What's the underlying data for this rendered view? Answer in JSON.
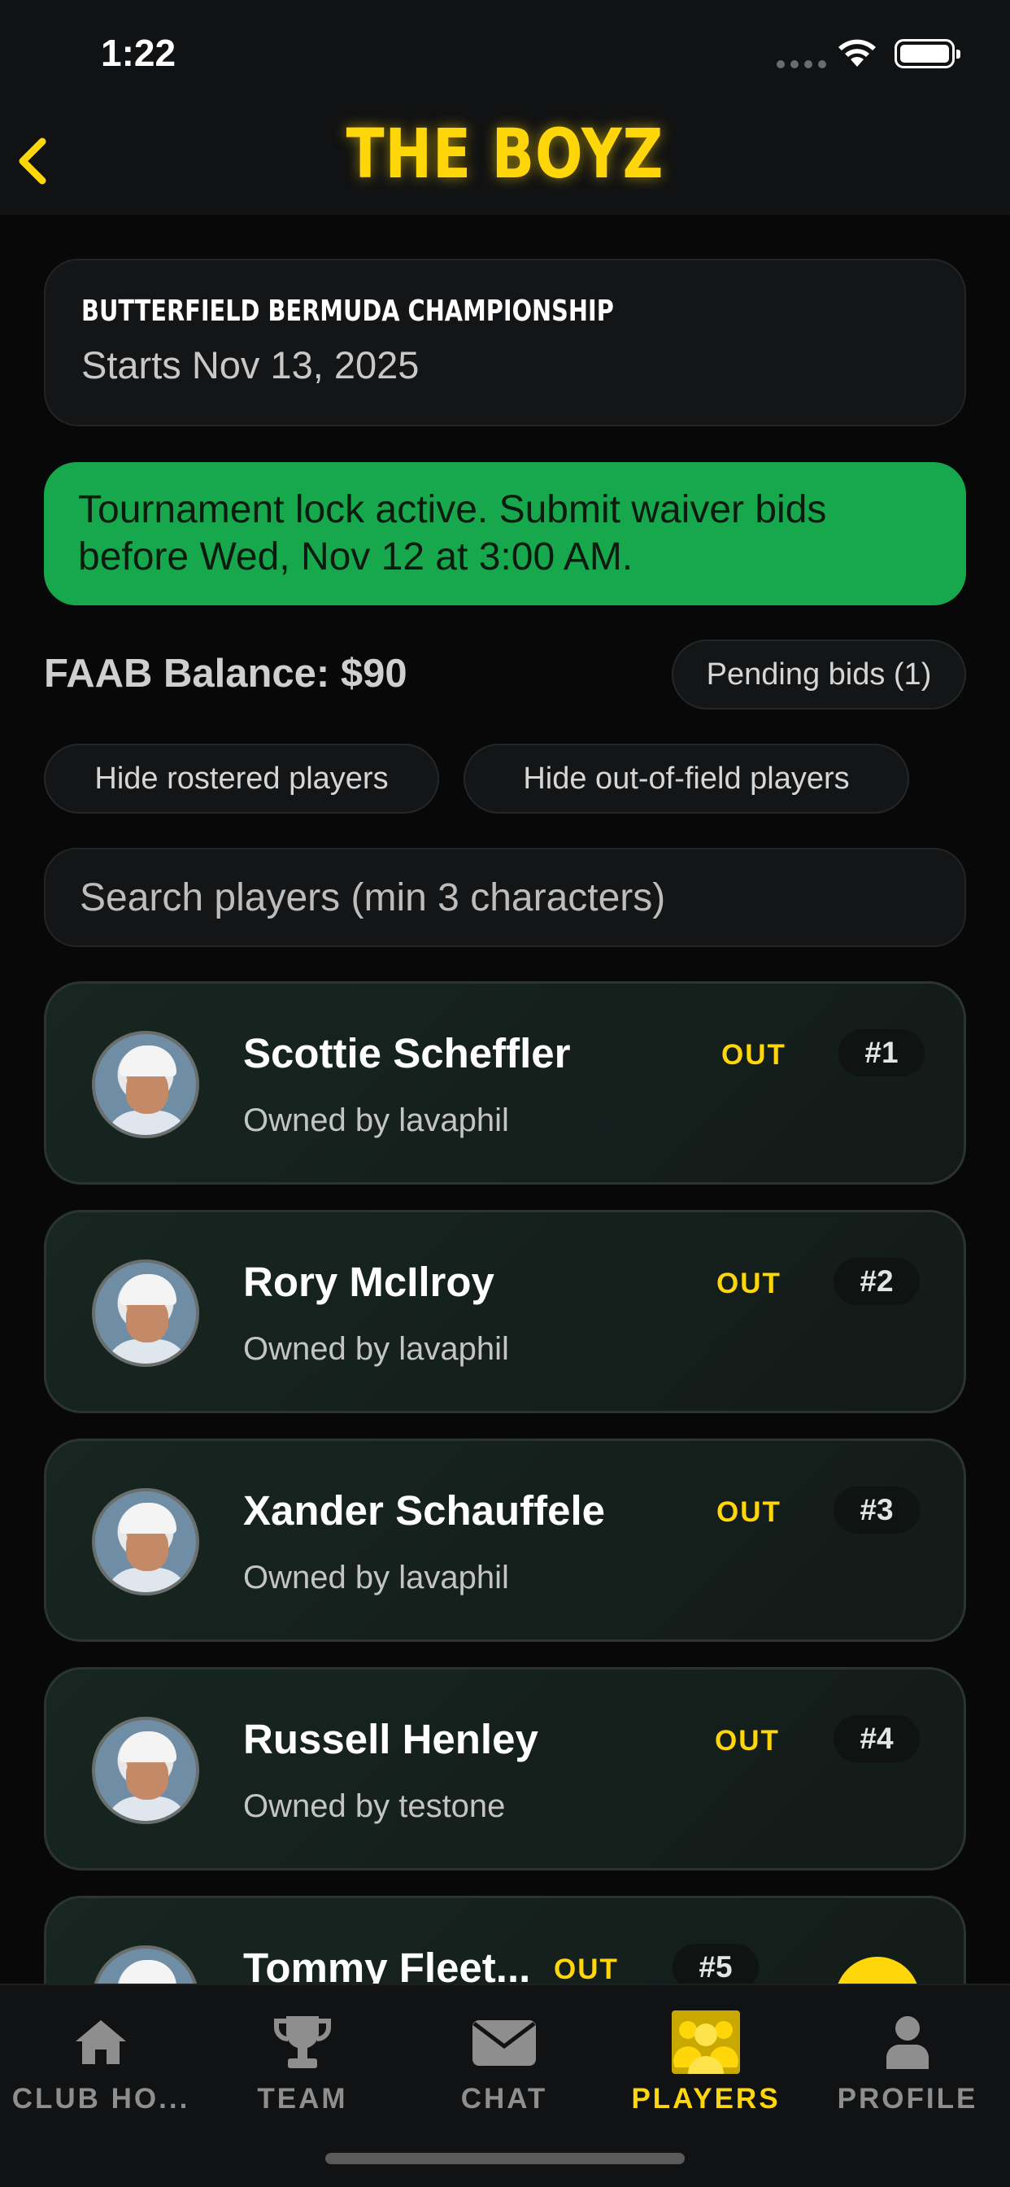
{
  "status_bar": {
    "time": "1:22"
  },
  "header": {
    "title": "THE BOYZ",
    "back_icon": "chevron-left-icon"
  },
  "tournament": {
    "name": "BUTTERFIELD BERMUDA CHAMPIONSHIP",
    "date": "Starts Nov 13, 2025"
  },
  "lock_banner": "Tournament lock active. Submit waiver bids before Wed, Nov 12 at 3:00 AM.",
  "faab_balance": "FAAB Balance: $90",
  "pending_bids": "Pending bids (1)",
  "filters": {
    "hide_rostered": "Hide rostered players",
    "hide_out_of_field": "Hide out-of-field players"
  },
  "search": {
    "placeholder": "Search players (min 3 characters)",
    "value": ""
  },
  "players": [
    {
      "name": "Scottie Scheffler",
      "owner": "Owned by lavaphil",
      "status": "OUT",
      "rank": "#1"
    },
    {
      "name": "Rory McIlroy",
      "owner": "Owned by lavaphil",
      "status": "OUT",
      "rank": "#2"
    },
    {
      "name": "Xander Schauffele",
      "owner": "Owned by lavaphil",
      "status": "OUT",
      "rank": "#3"
    },
    {
      "name": "Russell Henley",
      "owner": "Owned by testone",
      "status": "OUT",
      "rank": "#4"
    },
    {
      "name": "Tommy Fleet...",
      "owner": "",
      "status": "OUT",
      "rank": "#5"
    }
  ],
  "tabs": [
    {
      "label": "CLUB HO...",
      "icon": "home-icon",
      "active": false
    },
    {
      "label": "TEAM",
      "icon": "trophy-icon",
      "active": false
    },
    {
      "label": "CHAT",
      "icon": "envelope-icon",
      "active": false
    },
    {
      "label": "PLAYERS",
      "icon": "people-icon",
      "active": true
    },
    {
      "label": "PROFILE",
      "icon": "person-icon",
      "active": false
    }
  ],
  "colors": {
    "accent": "#FFD60A",
    "banner": "#17A84D",
    "background": "#080808"
  }
}
